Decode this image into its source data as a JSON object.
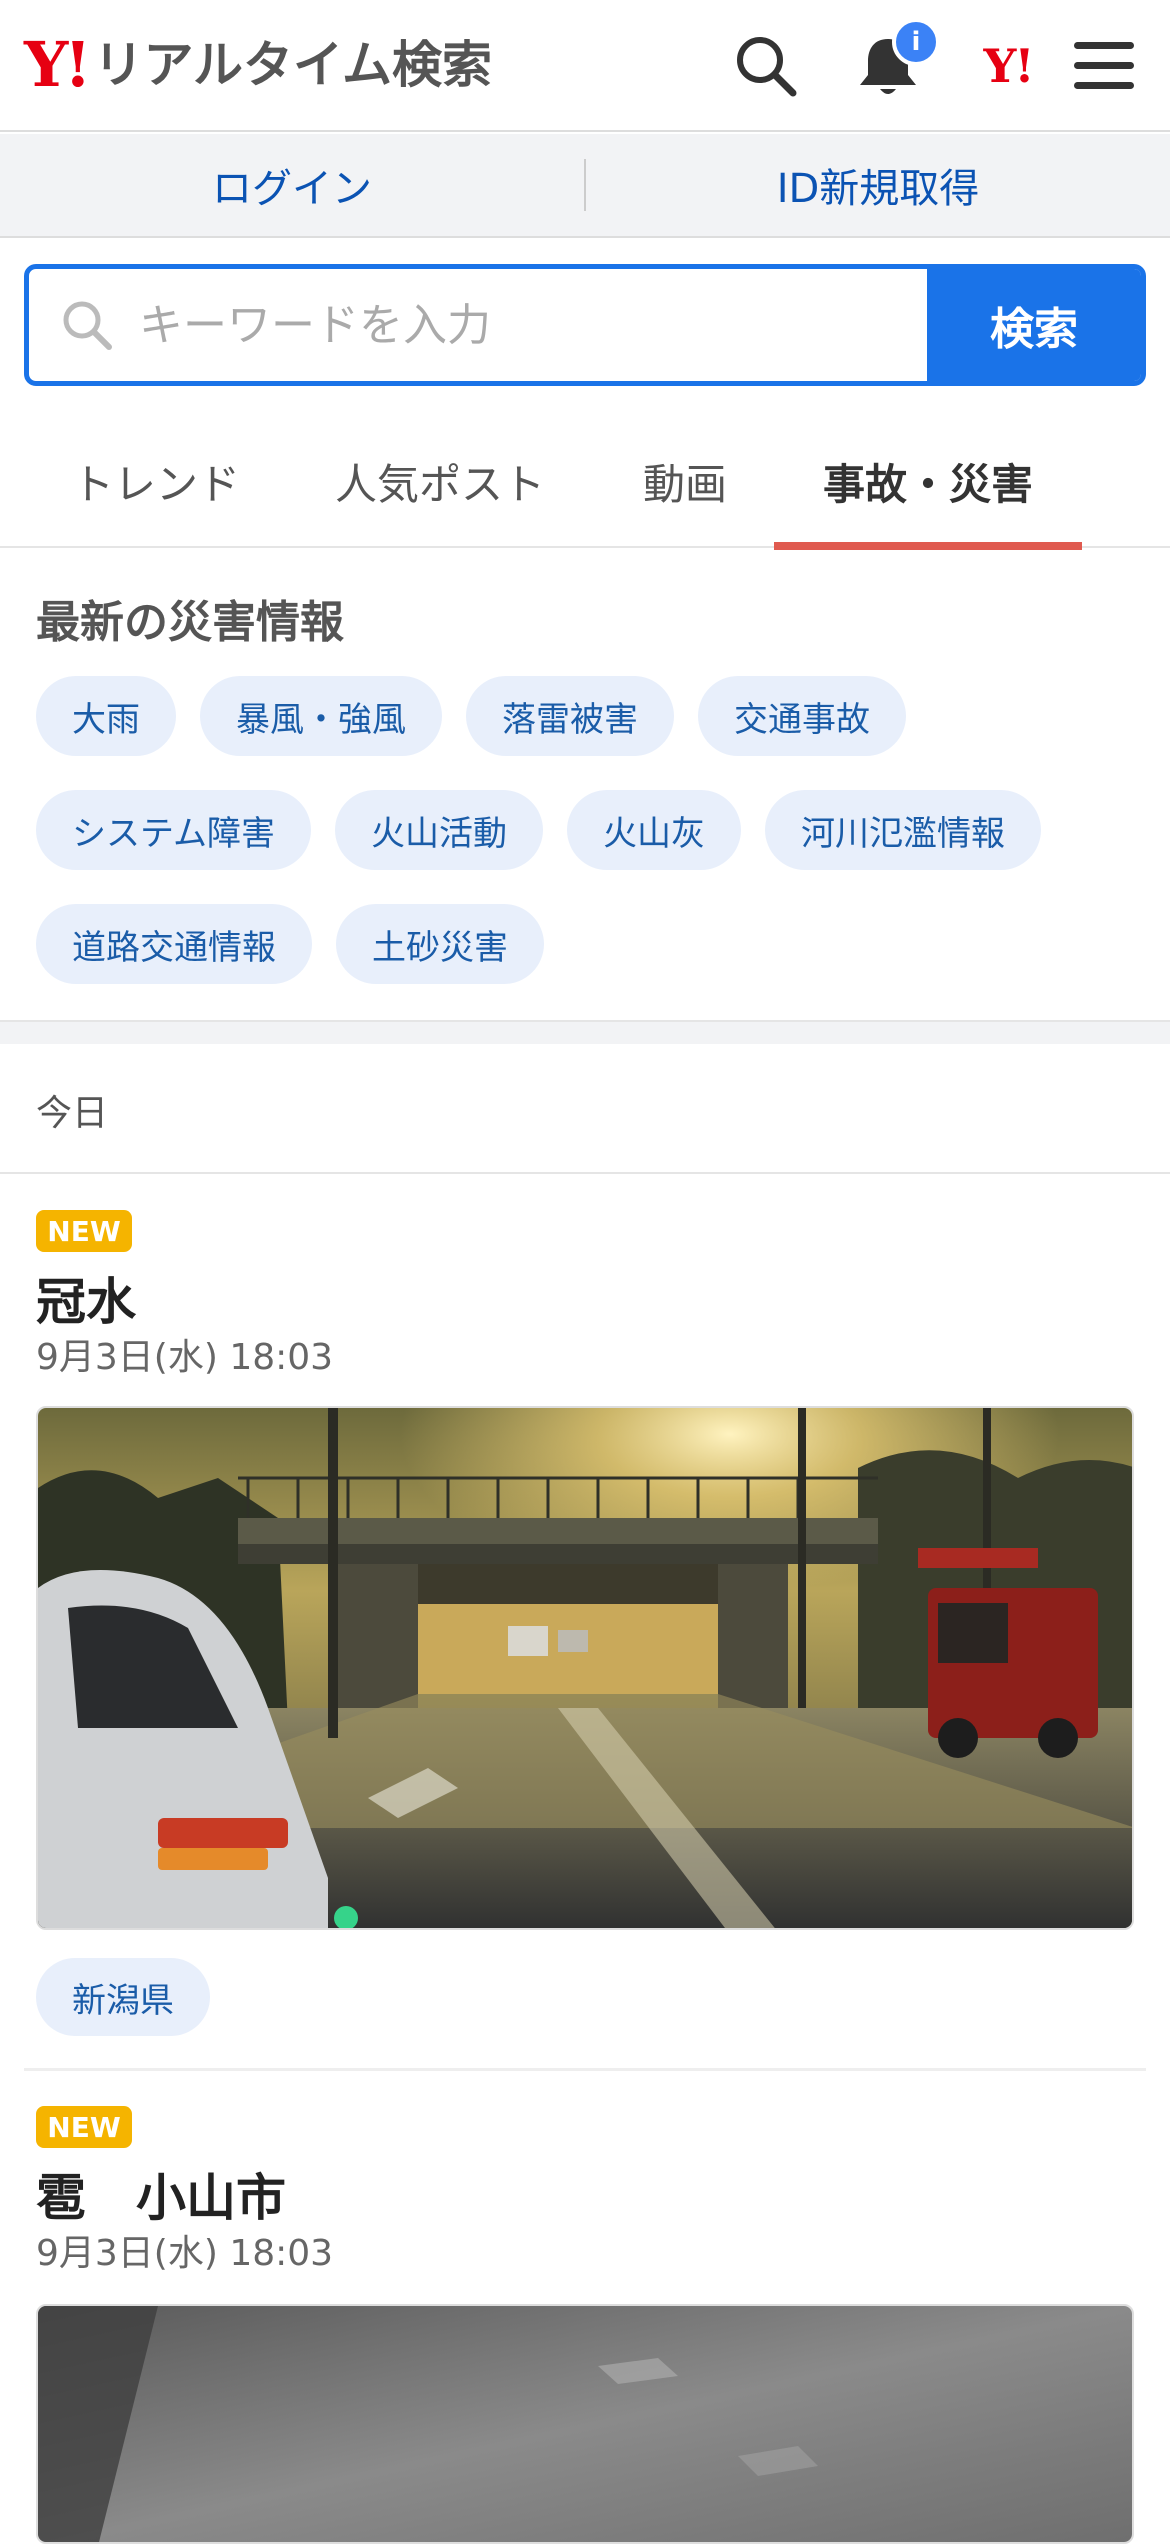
{
  "header": {
    "logo_mark": "Y!",
    "logo_text": "リアルタイム検索",
    "notification_badge": "i",
    "yahoo_mark": "Y!"
  },
  "auth": {
    "login": "ログイン",
    "signup": "ID新規取得"
  },
  "search": {
    "placeholder": "キーワードを入力",
    "button": "検索"
  },
  "tabs": [
    {
      "label": "トレンド"
    },
    {
      "label": "人気ポスト"
    },
    {
      "label": "動画"
    },
    {
      "label": "事故・災害",
      "active": true
    }
  ],
  "disaster": {
    "title": "最新の災害情報",
    "chips": [
      "大雨",
      "暴風・強風",
      "落雷被害",
      "交通事故",
      "システム障害",
      "火山活動",
      "火山灰",
      "河川氾濫情報",
      "道路交通情報",
      "土砂災害"
    ]
  },
  "feed": {
    "date_label": "今日",
    "posts": [
      {
        "badge": "NEW",
        "title": "冠水",
        "time": "9月3日(水) 18:03",
        "tag": "新潟県",
        "image": "flooded-underpass-photo"
      },
      {
        "badge": "NEW",
        "title": "雹　小山市",
        "time": "9月3日(水) 18:03",
        "image": "hail-photo"
      }
    ]
  },
  "colors": {
    "brand_red": "#e60012",
    "accent_blue": "#1a73e8",
    "tab_indicator": "#e05a4f",
    "new_badge": "#f5b400"
  }
}
